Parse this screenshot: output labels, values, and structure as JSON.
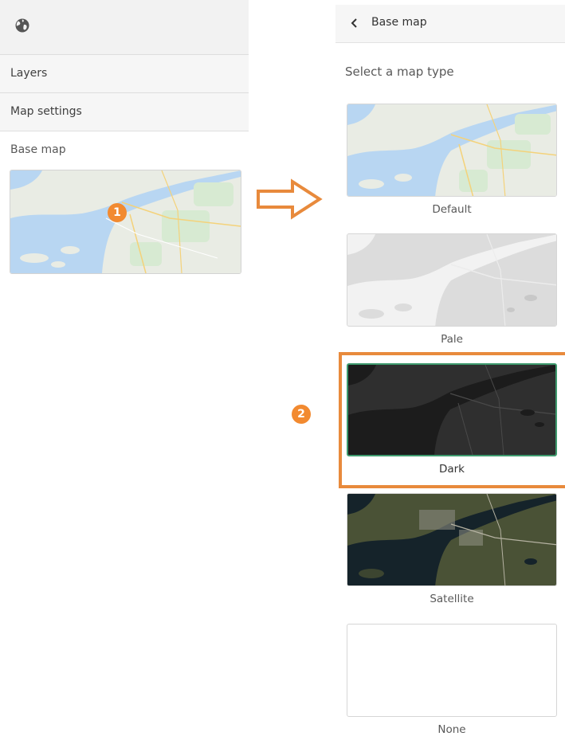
{
  "left_panel": {
    "menu_items": [
      "Layers",
      "Map settings"
    ],
    "base_map_label": "Base map"
  },
  "right_panel": {
    "title": "Base map",
    "select_label": "Select a map type",
    "options": [
      {
        "label": "Default",
        "selected": false
      },
      {
        "label": "Pale",
        "selected": false
      },
      {
        "label": "Dark",
        "selected": true
      },
      {
        "label": "Satellite",
        "selected": false
      },
      {
        "label": "None",
        "selected": false
      }
    ]
  },
  "callouts": [
    "1",
    "2"
  ],
  "icons": {
    "header": "globe-icon",
    "back": "chevron-left-icon",
    "arrow": "right-arrow-icon"
  },
  "colors": {
    "accent": "#f28a30",
    "selected_border": "#3e9a6e",
    "highlight_border": "#e88a3c"
  }
}
